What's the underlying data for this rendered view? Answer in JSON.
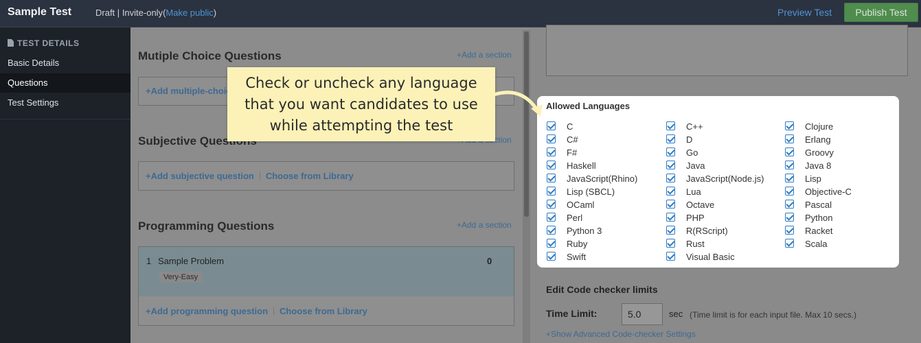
{
  "topbar": {
    "title": "Sample Test",
    "status": "Draft",
    "separator": "|",
    "visibility": "Invite-only",
    "make_public_link": "Make public",
    "preview_button": "Preview Test",
    "publish_button": "Publish Test"
  },
  "sidebar": {
    "heading": "TEST DETAILS",
    "items": [
      {
        "label": "Basic Details",
        "active": false
      },
      {
        "label": "Questions",
        "active": true
      },
      {
        "label": "Test Settings",
        "active": false
      }
    ]
  },
  "sections": {
    "add_section": "+Add a section",
    "mcq": {
      "title": "Mutiple Choice Questions",
      "add_link": "+Add multiple-choice question"
    },
    "subjective": {
      "title": "Subjective Questions",
      "add_link": "+Add subjective question",
      "library_link": "Choose from Library"
    },
    "programming": {
      "title": "Programming Questions",
      "problem": {
        "number": "1",
        "name": "Sample Problem",
        "score": "0",
        "difficulty": "Very-Easy"
      },
      "add_link": "+Add programming question",
      "library_link": "Choose from Library"
    }
  },
  "callout": {
    "line1": "Check or uncheck any language",
    "line2": "that you want candidates to use",
    "line3": "while attempting the test"
  },
  "allowed_languages": {
    "heading": "Allowed Languages",
    "columns": [
      [
        "C",
        "C#",
        "F#",
        "Haskell",
        "JavaScript(Rhino)",
        "Lisp (SBCL)",
        "OCaml",
        "Perl",
        "Python 3",
        "Ruby",
        "Swift"
      ],
      [
        "C++",
        "D",
        "Go",
        "Java",
        "JavaScript(Node.js)",
        "Lua",
        "Octave",
        "PHP",
        "R(RScript)",
        "Rust",
        "Visual Basic"
      ],
      [
        "Clojure",
        "Erlang",
        "Groovy",
        "Java 8",
        "Lisp",
        "Objective-C",
        "Pascal",
        "Python",
        "Racket",
        "Scala"
      ]
    ],
    "checked": true
  },
  "code_checker": {
    "title": "Edit Code checker limits",
    "time_label": "Time Limit:",
    "time_value": "5.0",
    "time_unit": "sec",
    "time_note": "(Time limit is for each input file. Max 10 secs.)",
    "advanced_link": "+Show Advanced Code-checker Settings"
  },
  "colors": {
    "accent_link": "#4f94d4",
    "publish_green": "#4f8c4e",
    "checkbox_blue": "#2f7bc2",
    "callout_yellow": "#fcf2b8"
  }
}
